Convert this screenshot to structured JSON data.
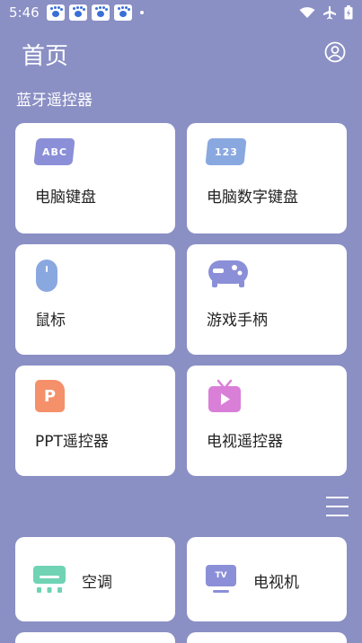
{
  "status_bar": {
    "time": "5:46",
    "notification_icons": [
      "paw-icon",
      "paw-icon",
      "paw-icon",
      "paw-icon"
    ],
    "right_icons": [
      "wifi-icon",
      "airplane-icon",
      "battery-icon"
    ]
  },
  "header": {
    "title": "首页",
    "avatar_icon": "user-circle-icon"
  },
  "section": {
    "title": "蓝牙遥控器"
  },
  "remotes": [
    {
      "label": "电脑键盘",
      "icon": "keyboard-abc-icon",
      "icon_text": "ABC",
      "color": "#8b8fd8"
    },
    {
      "label": "电脑数字键盘",
      "icon": "numpad-123-icon",
      "icon_text": "123",
      "color": "#8aa8e0"
    },
    {
      "label": "鼠标",
      "icon": "mouse-icon",
      "color": "#8aa8e0"
    },
    {
      "label": "游戏手柄",
      "icon": "gamepad-icon",
      "color": "#8b8fd8"
    },
    {
      "label": "PPT遥控器",
      "icon": "ppt-icon",
      "icon_text": "P",
      "color": "#f4906a"
    },
    {
      "label": "电视遥控器",
      "icon": "tv-play-icon",
      "color": "#d97fd8"
    }
  ],
  "devices": [
    {
      "label": "空调",
      "icon": "air-conditioner-icon",
      "color": "#6fd3b4"
    },
    {
      "label": "电视机",
      "icon": "tv-icon",
      "icon_text": "TV",
      "color": "#8b8fd8"
    }
  ],
  "menu_icon": "hamburger-menu-icon"
}
